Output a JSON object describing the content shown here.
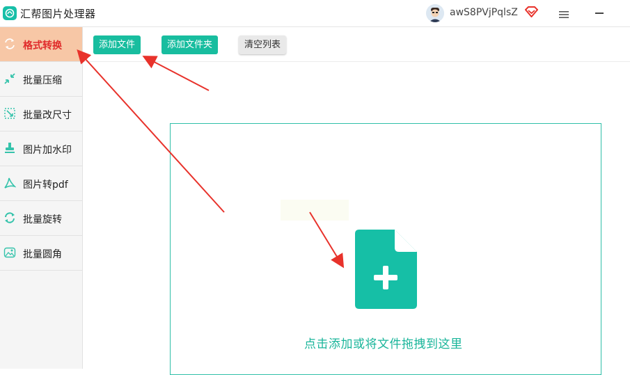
{
  "app": {
    "title": "汇帮图片处理器"
  },
  "user": {
    "name": "awS8PVjPqlsZ"
  },
  "icons": {
    "logo": "app-logo-icon",
    "vip": "vip-diamond-icon",
    "menu": "hamburger-menu-icon",
    "minimize": "minimize-icon"
  },
  "sidebar": {
    "items": [
      {
        "label": "格式转换",
        "icon": "format-convert-icon",
        "active": true
      },
      {
        "label": "批量压缩",
        "icon": "compress-icon",
        "active": false
      },
      {
        "label": "批量改尺寸",
        "icon": "resize-icon",
        "active": false
      },
      {
        "label": "图片加水印",
        "icon": "watermark-icon",
        "active": false
      },
      {
        "label": "图片转pdf",
        "icon": "pdf-icon",
        "active": false
      },
      {
        "label": "批量旋转",
        "icon": "rotate-icon",
        "active": false
      },
      {
        "label": "批量圆角",
        "icon": "round-corner-icon",
        "active": false
      }
    ]
  },
  "toolbar": {
    "add_file": "添加文件",
    "add_folder": "添加文件夹",
    "clear_list": "清空列表"
  },
  "dropzone": {
    "hint": "点击添加或将文件拖拽到这里",
    "icon": "add-file-icon"
  },
  "colors": {
    "accent": "#18bd9f",
    "active_tab_bg": "#f7c7a6",
    "active_tab_text": "#e02b2b",
    "annotation_arrow": "#e8322b"
  }
}
